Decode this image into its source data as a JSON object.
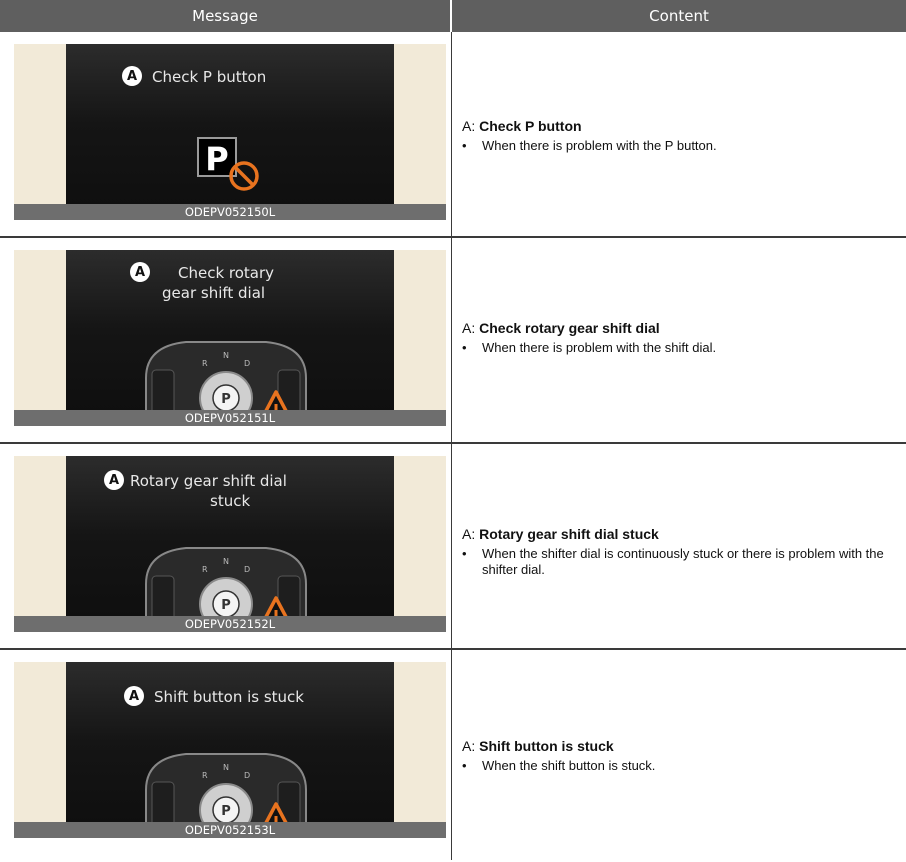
{
  "header": {
    "message": "Message",
    "content": "Content"
  },
  "rows": [
    {
      "msg_line1": "Check P button",
      "msg_line2": "",
      "code": "ODEPV052150L",
      "label": "A:",
      "title": "Check P button",
      "desc": "When there is problem with the P button."
    },
    {
      "msg_line1": "Check rotary",
      "msg_line2": "gear shift dial",
      "code": "ODEPV052151L",
      "label": "A:",
      "title": "Check rotary gear shift dial",
      "desc": "When there is problem with the shift dial."
    },
    {
      "msg_line1": "Rotary gear shift dial",
      "msg_line2": "stuck",
      "code": "ODEPV052152L",
      "label": "A:",
      "title": "Rotary gear shift dial stuck",
      "desc": "When the shifter dial is continuously stuck or there is problem with the shifter dial."
    },
    {
      "msg_line1": "Shift button is stuck",
      "msg_line2": "",
      "code": "ODEPV052153L",
      "label": "A:",
      "title": "Shift button is stuck",
      "desc": "When the shift button is stuck."
    }
  ],
  "badge": "A",
  "dial": {
    "p": "P",
    "r": "R",
    "n": "N",
    "d": "D"
  },
  "colors": {
    "warning": "#e8731f",
    "header_bg": "#5f5f5f",
    "panel_bg": "#f2ead8"
  }
}
